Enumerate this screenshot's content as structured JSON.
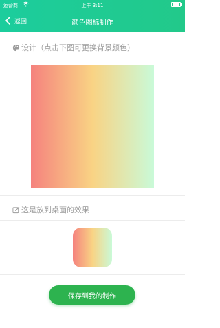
{
  "status_bar": {
    "carrier": "运营商",
    "time": "上午 3:11"
  },
  "nav": {
    "back_label": "返回",
    "title": "颜色图标制作"
  },
  "design_section": {
    "label": "设计（点击下图可更换背景颜色）",
    "icon": "palette-icon"
  },
  "preview_section": {
    "label": "这是放到桌面的效果",
    "icon": "edit-square-icon"
  },
  "gradient": {
    "colors": [
      "#f5827e",
      "#f9d384",
      "#c9fad8"
    ]
  },
  "save_button": {
    "label": "保存到我的制作"
  },
  "colors": {
    "header_start": "#1ccd9d",
    "header_end": "#22c98a",
    "button": "#2db34f"
  }
}
